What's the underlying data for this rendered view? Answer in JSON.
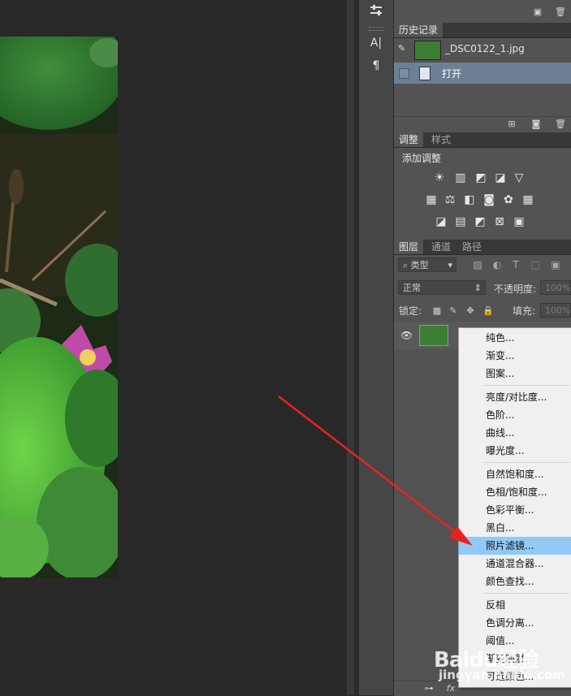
{
  "history_panel": {
    "tab_label": "历史记录",
    "snapshot_name": "_DSC0122_1.jpg",
    "steps": [
      {
        "label": "打开"
      }
    ]
  },
  "adjustments_panel": {
    "tabs": [
      "调整",
      "样式"
    ],
    "active_tab": "调整",
    "heading": "添加调整"
  },
  "layers_panel": {
    "tabs": [
      "图层",
      "通道",
      "路径"
    ],
    "active_tab": "图层",
    "filter_kind": "类型",
    "blend_mode": "正常",
    "opacity_label": "不透明度:",
    "opacity_value": "100%",
    "lock_label": "锁定:",
    "fill_label": "填充:",
    "fill_value": "100%"
  },
  "context_menu": {
    "groups": [
      [
        "纯色...",
        "渐变...",
        "图案..."
      ],
      [
        "亮度/对比度...",
        "色阶...",
        "曲线...",
        "曝光度..."
      ],
      [
        "自然饱和度...",
        "色相/饱和度...",
        "色彩平衡...",
        "黑白...",
        "照片滤镜...",
        "通道混合器...",
        "颜色查找..."
      ],
      [
        "反相",
        "色调分离...",
        "阈值...",
        "渐变映射...",
        "可选颜色..."
      ]
    ],
    "highlighted_item": "照片滤镜...",
    "highlight_color": "#91c9f7"
  },
  "annotation": {
    "arrow_color": "#e8231f"
  },
  "watermark": {
    "text": "Baidu经验",
    "sub": "jingyan.baidu.com"
  }
}
